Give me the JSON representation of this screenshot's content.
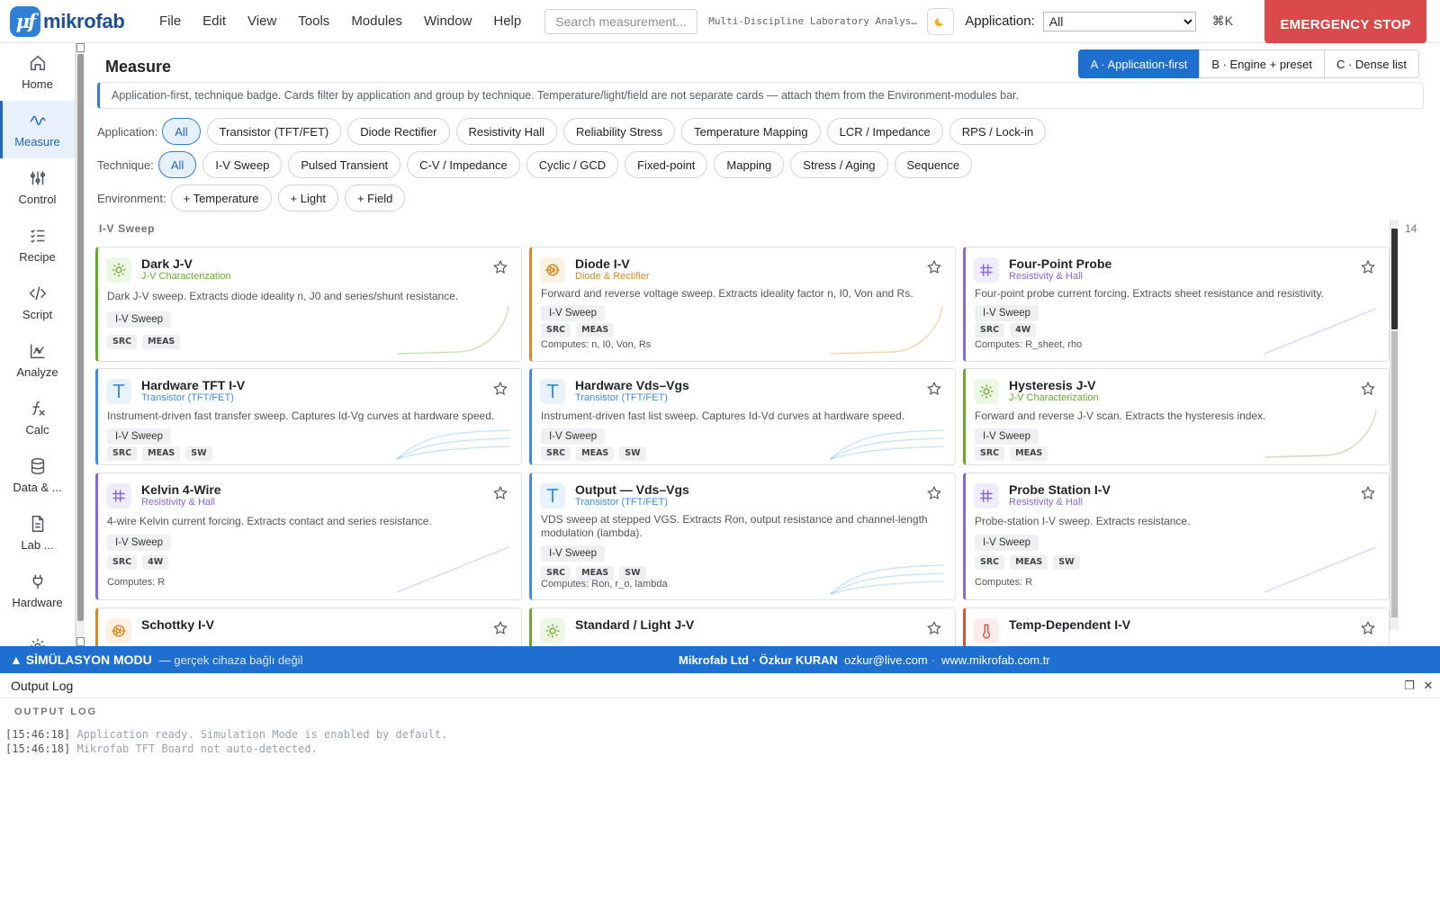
{
  "app": {
    "logo_text": "mikrofab",
    "menu": [
      "File",
      "Edit",
      "View",
      "Tools",
      "Modules",
      "Window",
      "Help"
    ],
    "search_placeholder": "Search measurement...",
    "doc_title": "Multi-Discipline Laboratory Analysis Platform",
    "application_label": "Application:",
    "application_value": "All",
    "shortcut": "⌘K",
    "emergency_stop": "EMERGENCY STOP"
  },
  "sidebar": {
    "items": [
      {
        "label": "Home",
        "icon": "home-icon"
      },
      {
        "label": "Measure",
        "icon": "waveform-icon",
        "active": true
      },
      {
        "label": "Control",
        "icon": "sliders-icon"
      },
      {
        "label": "Recipe",
        "icon": "checklist-icon"
      },
      {
        "label": "Script",
        "icon": "code-icon"
      },
      {
        "label": "Analyze",
        "icon": "chart-icon"
      },
      {
        "label": "Calc",
        "icon": "function-icon"
      },
      {
        "label": "Data & ...",
        "icon": "database-icon"
      },
      {
        "label": "Lab ...",
        "icon": "document-icon"
      },
      {
        "label": "Hardware",
        "icon": "plug-icon"
      },
      {
        "label": "",
        "icon": "gear-icon"
      }
    ]
  },
  "measure": {
    "title": "Measure",
    "layouts": [
      "A · Application-first",
      "B · Engine + preset",
      "C · Dense list"
    ],
    "active_layout": 0,
    "hint": "Application-first, technique badge. Cards filter by application and group by technique. Temperature/light/field are not separate cards — attach them from the Environment-modules bar.",
    "filters": {
      "application_label": "Application:",
      "application": [
        "All",
        "Transistor (TFT/FET)",
        "Diode  Rectifier",
        "Resistivity  Hall",
        "Reliability  Stress",
        "Temperature  Mapping",
        "LCR / Impedance",
        "RPS / Lock-in"
      ],
      "technique_label": "Technique:",
      "technique": [
        "All",
        "I-V Sweep",
        "Pulsed  Transient",
        "C-V / Impedance",
        "Cyclic / GCD",
        "Fixed-point",
        "Mapping",
        "Stress / Aging",
        "Sequence"
      ],
      "environment_label": "Environment:",
      "environment": [
        "+ Temperature",
        "+ Light",
        "+ Field"
      ]
    },
    "section": {
      "label": "I-V Sweep",
      "count": "14"
    },
    "cards": [
      {
        "title": "Dark J-V",
        "application": "J-V Characterization",
        "kind": "jv",
        "desc": "Dark J-V sweep. Extracts diode ideality n, J0 and series/shunt resistance.",
        "technique": "I-V Sweep",
        "tags": [
          "SRC",
          "MEAS"
        ],
        "computes": ""
      },
      {
        "title": "Diode I-V",
        "application": "Diode & Rectifier",
        "kind": "diode",
        "desc": "Forward and reverse voltage sweep. Extracts ideality factor n, I0, Von and Rs.",
        "technique": "I-V Sweep",
        "tags": [
          "SRC",
          "MEAS"
        ],
        "computes": "Computes: n, I0, Von, Rs"
      },
      {
        "title": "Four-Point Probe",
        "application": "Resistivity & Hall",
        "kind": "resist",
        "desc": "Four-point probe current forcing. Extracts sheet resistance and resistivity.",
        "technique": "I-V Sweep",
        "tags": [
          "SRC",
          "4W"
        ],
        "computes": "Computes: R_sheet, rho"
      },
      {
        "title": "Hardware TFT I-V",
        "application": "Transistor (TFT/FET)",
        "kind": "tft",
        "desc": "Instrument-driven fast transfer sweep. Captures Id-Vg curves at hardware speed.",
        "technique": "I-V Sweep",
        "tags": [
          "SRC",
          "MEAS",
          "SW"
        ],
        "computes": ""
      },
      {
        "title": "Hardware Vds–Vgs",
        "application": "Transistor (TFT/FET)",
        "kind": "tft",
        "desc": "Instrument-driven fast list sweep. Captures Id-Vd curves at hardware speed.",
        "technique": "I-V Sweep",
        "tags": [
          "SRC",
          "MEAS",
          "SW"
        ],
        "computes": ""
      },
      {
        "title": "Hysteresis J-V",
        "application": "J-V Characterization",
        "kind": "jv",
        "desc": "Forward and reverse J-V scan. Extracts the hysteresis index.",
        "technique": "I-V Sweep",
        "tags": [
          "SRC",
          "MEAS"
        ],
        "computes": ""
      },
      {
        "title": "Kelvin 4-Wire",
        "application": "Resistivity & Hall",
        "kind": "resist",
        "desc": "4-wire Kelvin current forcing. Extracts contact and series resistance.",
        "technique": "I-V Sweep",
        "tags": [
          "SRC",
          "4W"
        ],
        "computes": "Computes: R"
      },
      {
        "title": "Output — Vds–Vgs",
        "application": "Transistor (TFT/FET)",
        "kind": "tft",
        "desc": "VDS sweep at stepped VGS. Extracts Ron, output resistance and channel-length modulation (lambda).",
        "technique": "I-V Sweep",
        "tags": [
          "SRC",
          "MEAS",
          "SW"
        ],
        "computes": "Computes: Ron, r_o, lambda"
      },
      {
        "title": "Probe Station I-V",
        "application": "Resistivity & Hall",
        "kind": "resist",
        "desc": "Probe-station I-V sweep. Extracts resistance.",
        "technique": "I-V Sweep",
        "tags": [
          "SRC",
          "MEAS",
          "SW"
        ],
        "computes": "Computes: R"
      },
      {
        "title": "Schottky I-V",
        "application": "",
        "kind": "diode",
        "desc": "",
        "technique": "",
        "tags": [],
        "computes": ""
      },
      {
        "title": "Standard / Light J-V",
        "application": "",
        "kind": "jv",
        "desc": "",
        "technique": "",
        "tags": [],
        "computes": ""
      },
      {
        "title": "Temp-Dependent I-V",
        "application": "",
        "kind": "temp",
        "desc": "",
        "technique": "",
        "tags": [],
        "computes": ""
      }
    ]
  },
  "status": {
    "mode": "▲ SİMÜLASYON MODU",
    "note": "— gerçek cihaza bağlı değil",
    "company": "Mikrofab Ltd · Özkur KURAN",
    "email": "ozkur@live.com",
    "website": "www.mikrofab.com.tr"
  },
  "log": {
    "title": "Output Log",
    "subtitle": "OUTPUT LOG",
    "lines": [
      {
        "time": "[15:46:18]",
        "msg": "Application ready. Simulation Mode is enabled by default."
      },
      {
        "time": "[15:46:18]",
        "msg": "Mikrofab TFT Board not auto-detected."
      }
    ]
  },
  "colors": {
    "accent": "#1f6fd1",
    "jv": "#6aaa2a",
    "diode": "#d9881f",
    "resist": "#8a66d8",
    "tft": "#3b8ee6",
    "temp": "#d9503f",
    "estop": "#d94a4a"
  }
}
